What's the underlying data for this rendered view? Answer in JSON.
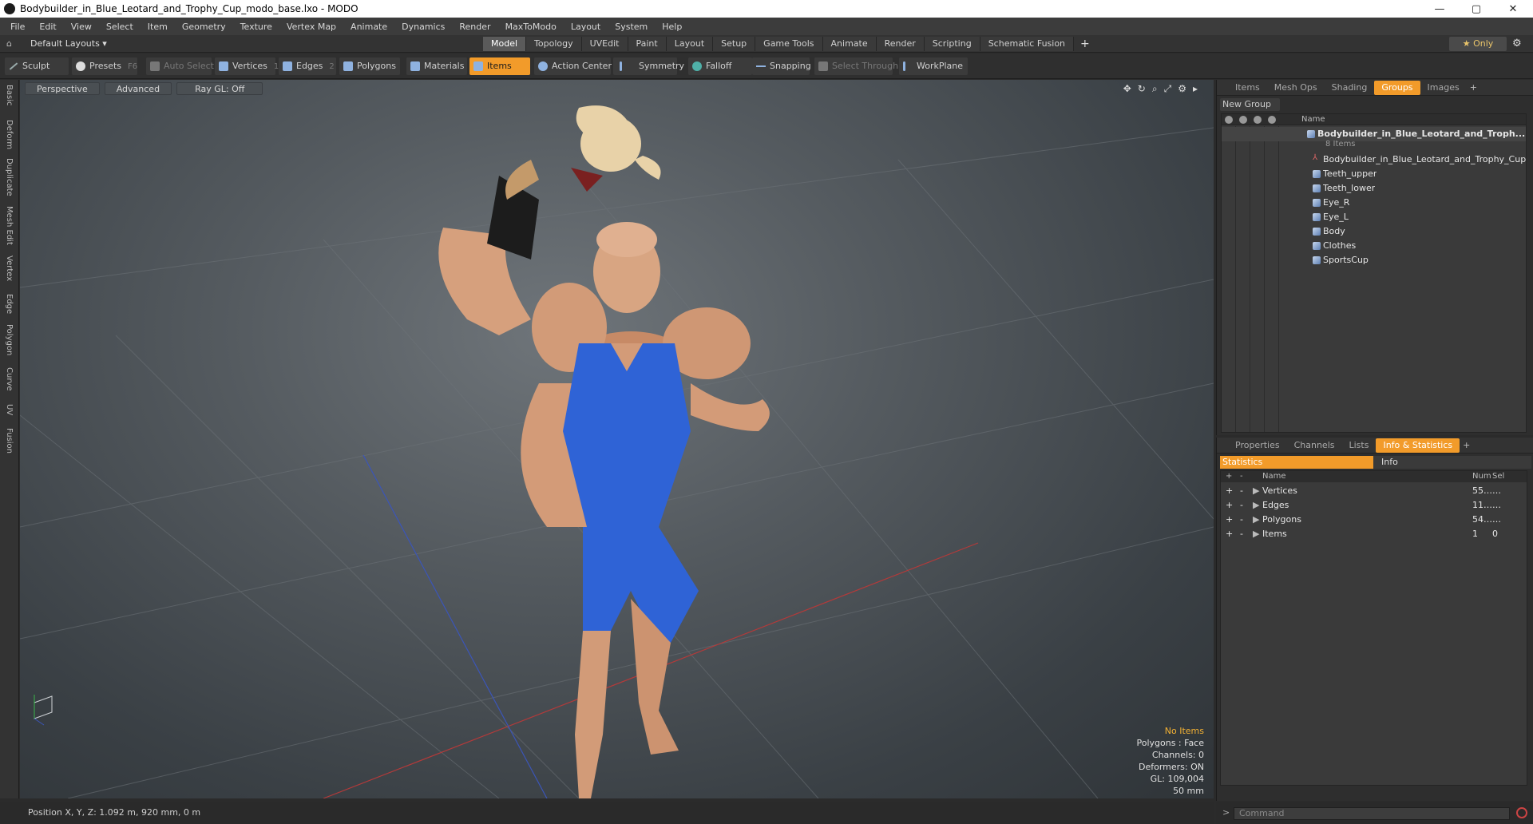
{
  "window": {
    "title": "Bodybuilder_in_Blue_Leotard_and_Trophy_Cup_modo_base.lxo - MODO",
    "controls": [
      "—",
      "▢",
      "✕"
    ]
  },
  "menu": [
    "File",
    "Edit",
    "View",
    "Select",
    "Item",
    "Geometry",
    "Texture",
    "Vertex Map",
    "Animate",
    "Dynamics",
    "Render",
    "MaxToModo",
    "Layout",
    "System",
    "Help"
  ],
  "layoutbar": {
    "default_layouts": "Default Layouts ▾",
    "tabs": [
      "Model",
      "Topology",
      "UVEdit",
      "Paint",
      "Layout",
      "Setup",
      "Game Tools",
      "Animate",
      "Render",
      "Scripting",
      "Schematic Fusion"
    ],
    "active_tab": "Model",
    "only_label": "★  Only"
  },
  "toolbar": {
    "sculpt": "Sculpt",
    "presets": "Presets",
    "presets_key": "F6",
    "auto_select": "Auto Select",
    "vertices": "Vertices",
    "vertices_key": "1",
    "edges": "Edges",
    "edges_key": "2",
    "polygons": "Polygons",
    "materials": "Materials",
    "items": "Items",
    "action_center": "Action Center",
    "symmetry": "Symmetry",
    "falloff": "Falloff",
    "snapping": "Snapping",
    "select_through": "Select Through",
    "workplane": "WorkPlane"
  },
  "left_tabs": [
    "Basic",
    "Deform",
    "Duplicate",
    "Mesh Edit",
    "Vertex",
    "Edge",
    "Polygon",
    "Curve",
    "UV",
    "Fusion"
  ],
  "viewport": {
    "view": "Perspective",
    "shading": "Advanced",
    "raygl": "Ray GL: Off",
    "stats": {
      "selection": "No Items",
      "polygons": "Polygons : Face",
      "channels": "Channels: 0",
      "deformers": "Deformers: ON",
      "gl": "GL: 109,004",
      "grid": "50 mm"
    }
  },
  "groups_panel": {
    "tabs": [
      "Items",
      "Mesh Ops",
      "Shading",
      "Groups",
      "Images"
    ],
    "active_tab": "Groups",
    "new_group": "New Group",
    "name_header": "Name",
    "group_name": "Bodybuilder_in_Blue_Leotard_and_Troph...",
    "group_count": "8 Items",
    "items": [
      "Bodybuilder_in_Blue_Leotard_and_Trophy_Cup",
      "Teeth_upper",
      "Teeth_lower",
      "Eye_R",
      "Eye_L",
      "Body",
      "Clothes",
      "SportsCup"
    ]
  },
  "stats_panel": {
    "tabs": [
      "Properties",
      "Channels",
      "Lists",
      "Info & Statistics"
    ],
    "active_tab": "Info & Statistics",
    "statistics_label": "Statistics",
    "info_label": "Info",
    "headers": {
      "name": "Name",
      "num": "Num",
      "sel": "Sel"
    },
    "rows": [
      {
        "name": "Vertices",
        "num": "55…",
        "sel": "…"
      },
      {
        "name": "Edges",
        "num": "11…",
        "sel": "…"
      },
      {
        "name": "Polygons",
        "num": "54…",
        "sel": "…"
      },
      {
        "name": "Items",
        "num": "1",
        "sel": "0"
      }
    ]
  },
  "statusbar": {
    "position": "Position X, Y, Z:   1.092 m, 920 mm, 0 m"
  },
  "command": {
    "placeholder": "Command"
  },
  "colors": {
    "accent": "#f29b2a",
    "viewport_bg": "#555b60",
    "leotard": "#2f63d6",
    "skin": "#d9a27f"
  }
}
